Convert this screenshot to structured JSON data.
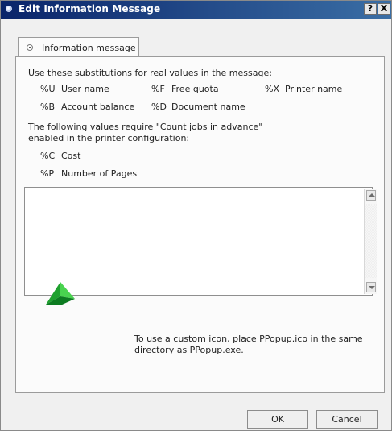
{
  "window": {
    "title": "Edit Information Message",
    "help_button": "?",
    "close_button": "X"
  },
  "tabs": [
    {
      "label": "Information message"
    }
  ],
  "panel": {
    "intro": "Use these substitutions for real values in the message:",
    "subs": [
      {
        "code": "%U",
        "label": "User name"
      },
      {
        "code": "%F",
        "label": "Free quota"
      },
      {
        "code": "%X",
        "label": "Printer name"
      },
      {
        "code": "%B",
        "label": "Account balance"
      },
      {
        "code": "%D",
        "label": "Document name"
      }
    ],
    "note_line1": "The following values require \"Count jobs in advance\"",
    "note_line2": "enabled in the printer configuration:",
    "extra_subs": [
      {
        "code": "%C",
        "label": "Cost"
      },
      {
        "code": "%P",
        "label": "Number of Pages"
      }
    ],
    "message_text": "",
    "icon_hint_line1": "To use a custom icon, place PPopup.ico in the same",
    "icon_hint_line2": "directory as PPopup.exe."
  },
  "buttons": {
    "ok": "OK",
    "cancel": "Cancel"
  },
  "icons": {
    "title": "window-app-icon",
    "tab": "radio-icon",
    "preview": "green-pyramid-icon"
  }
}
